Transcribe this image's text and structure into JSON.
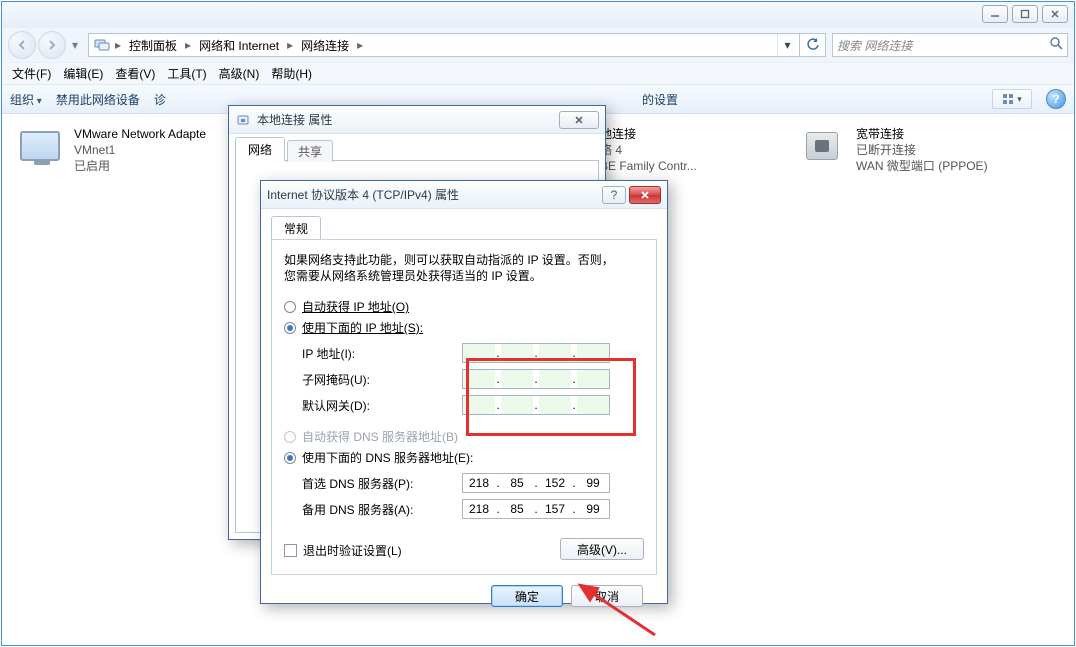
{
  "window_controls": {
    "min": "—",
    "max": "▢",
    "close": "✕"
  },
  "breadcrumb": {
    "seg1": "控制面板",
    "seg2": "网络和 Internet",
    "seg3": "网络连接"
  },
  "search": {
    "placeholder": "搜索 网络连接"
  },
  "menu": {
    "file": "文件(F)",
    "edit": "编辑(E)",
    "view": "查看(V)",
    "tools": "工具(T)",
    "advanced": "高级(N)",
    "help": "帮助(H)"
  },
  "cmdbar": {
    "organize": "组织",
    "disable": "禁用此网络设备",
    "diagnose": "诊",
    "settings_tail": "的设置"
  },
  "connections": {
    "vmnet1": {
      "name": "VMware Network Adapte",
      "line2": "VMnet1",
      "status": "已启用"
    },
    "local": {
      "name_tail": "地连接",
      "line2_tail": "络 4",
      "adapter_tail": "BE Family Contr..."
    },
    "broadband": {
      "name": "宽带连接",
      "status": "已断开连接",
      "adapter": "WAN 微型端口 (PPPOE)"
    }
  },
  "props_dialog": {
    "title": "本地连接 属性",
    "tab_network": "网络",
    "tab_share": "共享"
  },
  "ipv4_dialog": {
    "title": "Internet 协议版本 4 (TCP/IPv4) 属性",
    "tab_general": "常规",
    "desc1": "如果网络支持此功能，则可以获取自动指派的 IP 设置。否则，",
    "desc2": "您需要从网络系统管理员处获得适当的 IP 设置。",
    "ip_auto": "自动获得 IP 地址(O)",
    "ip_manual": "使用下面的 IP 地址(S):",
    "ip_addr_label": "IP 地址(I):",
    "subnet_label": "子网掩码(U):",
    "gateway_label": "默认网关(D):",
    "dns_auto": "自动获得 DNS 服务器地址(B)",
    "dns_manual": "使用下面的 DNS 服务器地址(E):",
    "pref_dns_label": "首选 DNS 服务器(P):",
    "alt_dns_label": "备用 DNS 服务器(A):",
    "pref_dns": [
      "218",
      "85",
      "152",
      "99"
    ],
    "alt_dns": [
      "218",
      "85",
      "157",
      "99"
    ],
    "validate": "退出时验证设置(L)",
    "advanced": "高级(V)...",
    "ok": "确定",
    "cancel": "取消"
  }
}
